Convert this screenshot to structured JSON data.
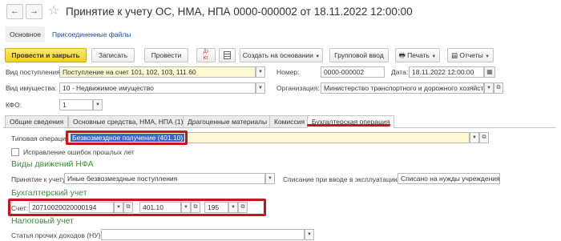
{
  "header": {
    "back_icon": "←",
    "forward_icon": "→",
    "title": "Принятие к учету ОС, НМА, НПА 0000-000002 от 18.11.2022 12:00:00"
  },
  "section_tabs": [
    {
      "label": "Основное"
    },
    {
      "label": "Присоединенные файлы"
    }
  ],
  "toolbar": {
    "post_close": "Провести и закрыть",
    "save": "Записать",
    "post": "Провести",
    "dt_kt": "Дт Кт",
    "create_based": "Создать на основании",
    "group_input": "Групповой ввод",
    "print": "Печать",
    "reports": "Отчеты"
  },
  "fields": {
    "receipt_type_label": "Вид поступления:",
    "receipt_type_value": "Поступление на счет 101, 102, 103, 111.60",
    "number_label": "Номер:",
    "number_value": "0000-000002",
    "date_label": "Дата:",
    "date_value": "18.11.2022 12:00:00",
    "property_type_label": "Вид имущества:",
    "property_type_value": "10 - Недвижимое имущество",
    "organization_label": "Организация:",
    "organization_value": "Министерство транспортного и дорожного хозяйства",
    "kfo_label": "КФО:",
    "kfo_value": "1"
  },
  "tabs": [
    {
      "label": "Общие сведения"
    },
    {
      "label": "Основные средства, НМА, НПА (1)"
    },
    {
      "label": "Драгоценные материалы"
    },
    {
      "label": "Комиссия"
    },
    {
      "label": "Бухгалтерская операция"
    }
  ],
  "operation": {
    "typical_label": "Типовая операция:",
    "typical_value": "Безвозмездное получение (401.10)",
    "correction_label": "Исправление ошибок прошлых лет",
    "nfa_title": "Виды движений НФА",
    "accept_label": "Принятие к учету:",
    "accept_value": "Иные безвозмездные поступления",
    "writeoff_label": "Списание при вводе в эксплуатацию:",
    "writeoff_value": "Списано на нужды учреждения",
    "accounting_title": "Бухгалтерский учет",
    "account_label": "Счет:",
    "account_value": "20710020020000194",
    "subaccount1": "401.10",
    "subaccount2": "195",
    "tax_title": "Налоговый учет",
    "income_label": "Статья прочих доходов (НУ):",
    "income_value": ""
  },
  "colors": {
    "primary_button": "#f2cf1f",
    "highlight_red": "#c8141e",
    "section_green": "#3d8c3d",
    "link_blue": "#1a4b9b",
    "selected_text_bg": "#3a66c8"
  },
  "icons": {
    "star": "star-icon",
    "print": "printer-icon",
    "reports": "report-icon",
    "table": "table-icon"
  }
}
